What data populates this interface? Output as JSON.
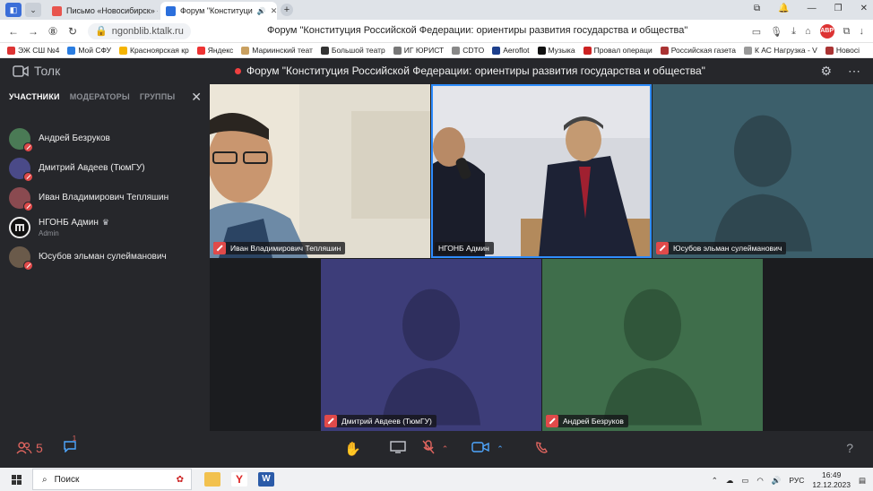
{
  "browser": {
    "tabs": [
      {
        "label": "Письмо «Новосибирск» -",
        "active": false
      },
      {
        "label": "Форум \"Конституци",
        "active": true
      }
    ],
    "url": "ngonblib.ktalk.ru",
    "page_title": "Форум \"Конституция Российской Федерации: ориентиры развития государства и общества\"",
    "bookmarks": [
      "ЭЖ СШ №4",
      "Мой СФУ",
      "Красноярская кр",
      "Яндекс",
      "Мариинский теат",
      "Большой театр",
      "ИГ ЮРИСТ",
      "СDTO",
      "Aeroflot",
      "Музыка",
      "Провал операци",
      "Российская газета",
      "К АС Нагрузка - V",
      "Новосі"
    ],
    "adblock_label": "АВР"
  },
  "app": {
    "name": "Толк",
    "meeting_title": "Форум \"Конституция Российской Федерации: ориентиры развития государства и общества\""
  },
  "sidebar": {
    "tabs": [
      "УЧАСТНИКИ",
      "МОДЕРАТОРЫ",
      "ГРУППЫ"
    ],
    "participants": [
      {
        "name": "Андрей Безруков",
        "sub": "",
        "color": "#4a7a55"
      },
      {
        "name": "Дмитрий Авдеев (ТюмГУ)",
        "sub": "",
        "color": "#4a4a88"
      },
      {
        "name": "Иван Владимирович Тепляшин",
        "sub": "",
        "color": "#8a4a50"
      },
      {
        "name": "НГОНБ Админ",
        "sub": "Admin",
        "color": "#111111"
      },
      {
        "name": "Юсубов эльман сулейманович",
        "sub": "",
        "color": "#6a5a4a"
      }
    ]
  },
  "tiles": [
    {
      "name": "Иван Владимирович Тепляшин",
      "kind": "video"
    },
    {
      "name": "НГОНБ Админ",
      "kind": "video"
    },
    {
      "name": "Юсубов эльман сулейманович",
      "kind": "avatar",
      "color": "#3c5f6b"
    },
    {
      "name": "Дмитрий Авдеев (ТюмГУ)",
      "kind": "avatar",
      "color": "#3d3d79"
    },
    {
      "name": "Андрей Безруков",
      "kind": "avatar",
      "color": "#3f6e4b"
    }
  ],
  "toolbar": {
    "participant_count": "5",
    "chat_badge": "1",
    "help": "?"
  },
  "taskbar": {
    "search_placeholder": "Поиск",
    "lang": "РУС",
    "time": "16:49",
    "date": "12.12.2023"
  }
}
